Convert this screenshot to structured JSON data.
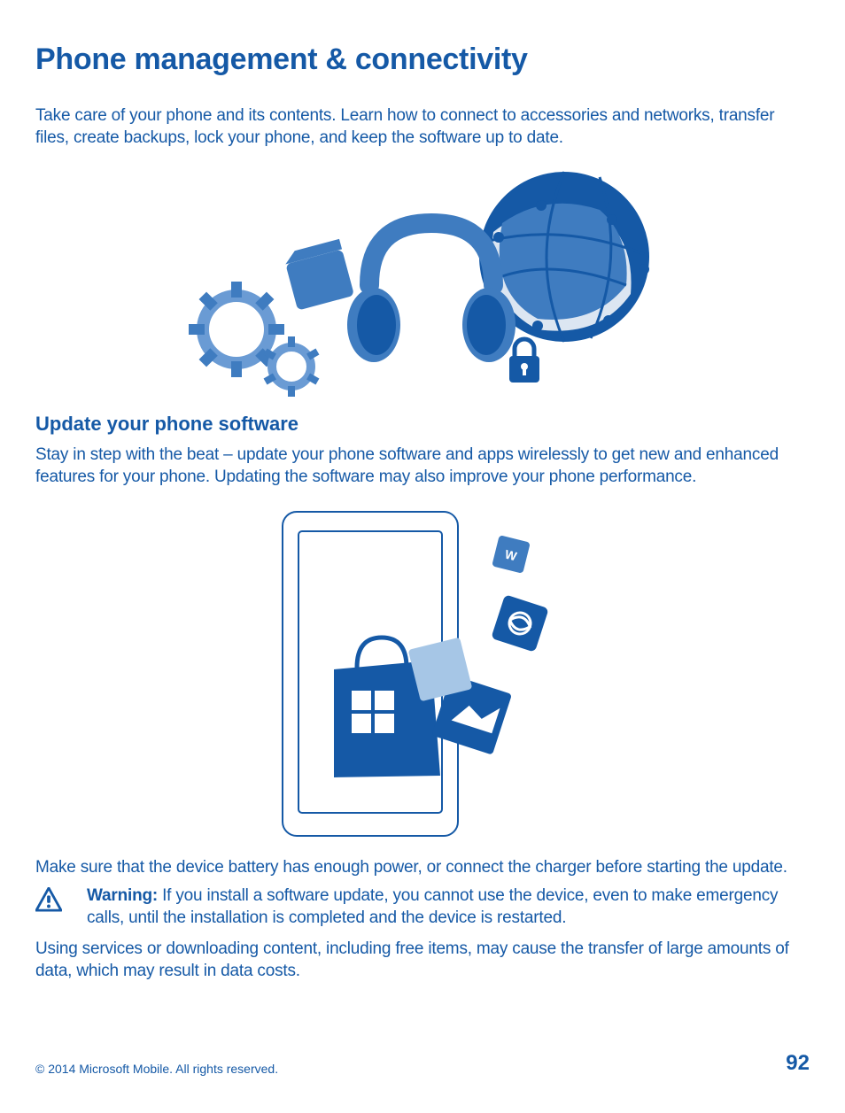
{
  "title": "Phone management & connectivity",
  "intro": "Take care of your phone and its contents. Learn how to connect to accessories and networks, transfer files, create backups, lock your phone, and keep the software up to date.",
  "section1": {
    "heading": "Update your phone software",
    "p1": "Stay in step with the beat – update your phone software and apps wirelessly to get new and enhanced features for your phone. Updating the software may also improve your phone performance.",
    "p2": "Make sure that the device battery has enough power, or connect the charger before starting the update.",
    "warning_label": "Warning:",
    "warning_text": " If you install a software update, you cannot use the device, even to make emergency calls, until the installation is completed and the device is restarted.",
    "p3": "Using services or downloading content, including free items, may cause the transfer of large amounts of data, which may result in data costs."
  },
  "footer": {
    "copyright": "© 2014 Microsoft Mobile. All rights reserved.",
    "page": "92"
  }
}
